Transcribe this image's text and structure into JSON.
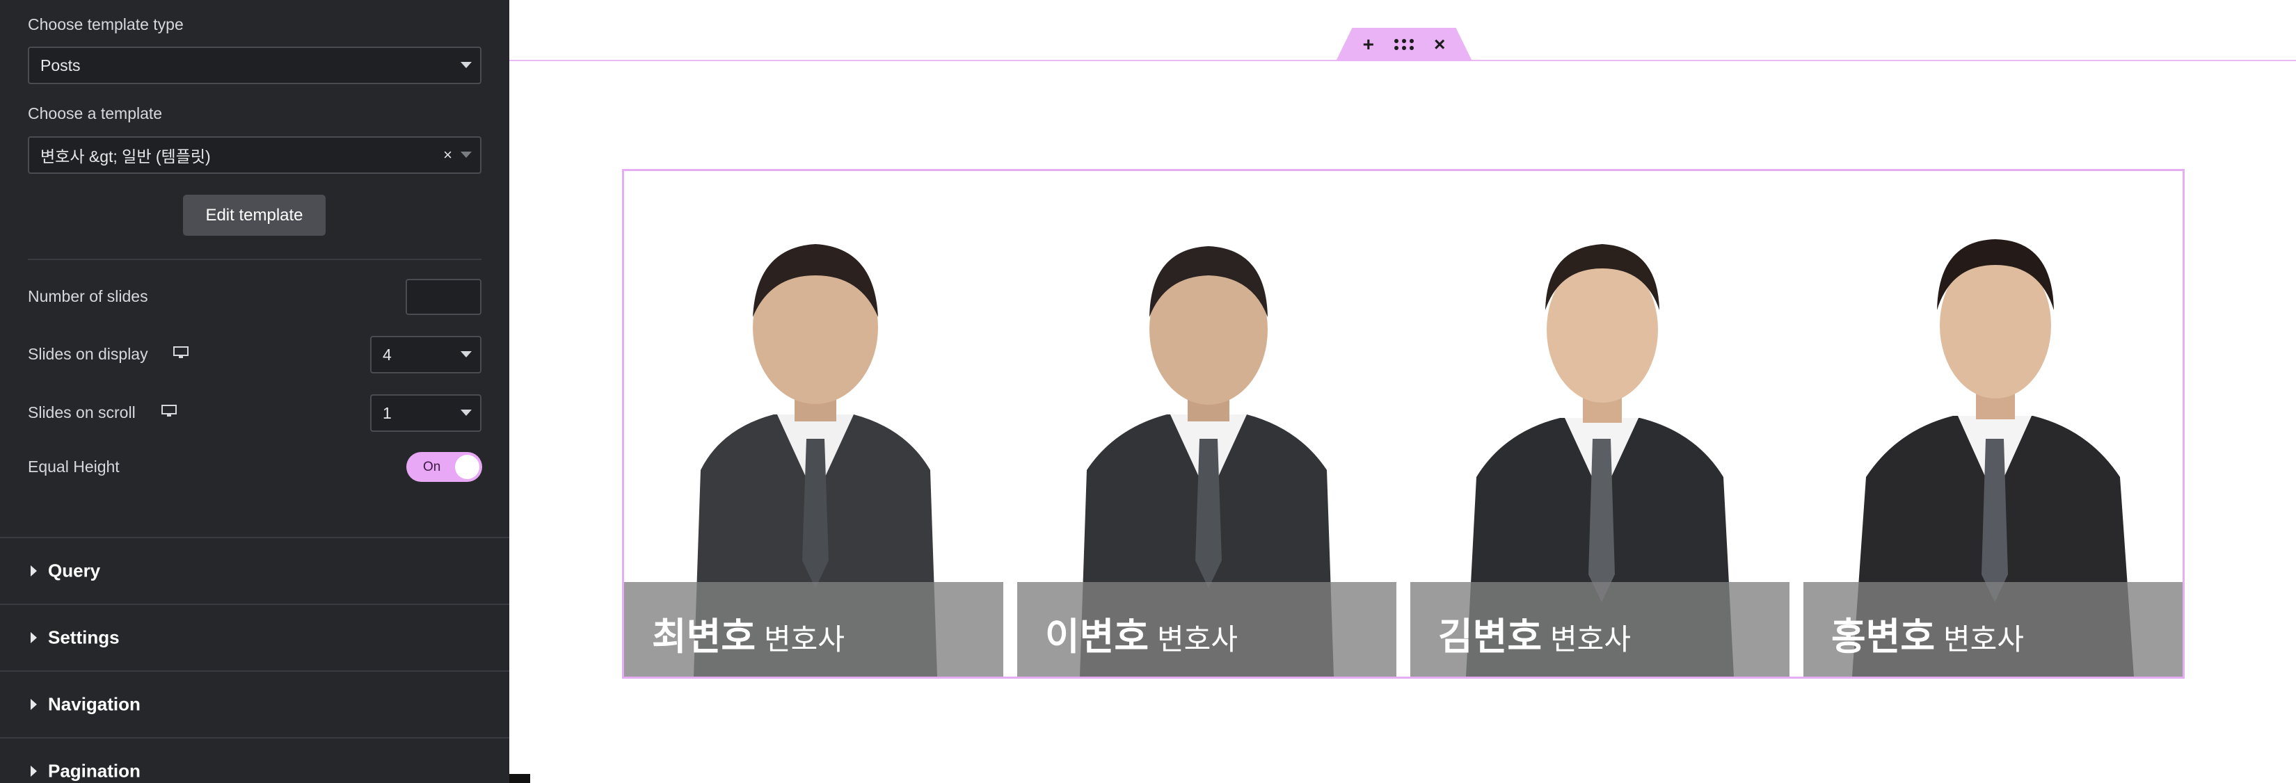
{
  "panel": {
    "template_type_label": "Choose template type",
    "template_type_value": "Posts",
    "template_label": "Choose a template",
    "template_value": "변호사 &gt; 일반 (템플릿)",
    "edit_template_label": "Edit template",
    "num_slides_label": "Number of slides",
    "num_slides_value": "",
    "slides_display_label": "Slides on display",
    "slides_display_value": "4",
    "slides_scroll_label": "Slides on scroll",
    "slides_scroll_value": "1",
    "equal_height_label": "Equal Height",
    "equal_height_value": "On",
    "sections": [
      {
        "label": "Query"
      },
      {
        "label": "Settings"
      },
      {
        "label": "Navigation"
      },
      {
        "label": "Pagination"
      }
    ]
  },
  "canvas": {
    "handle_icons": [
      "plus-icon",
      "drag-handle-icon",
      "close-icon"
    ],
    "handle_plus": "+",
    "handle_close": "×",
    "prev_arrow": "‹",
    "next_arrow": "›",
    "slides": [
      {
        "name": "최변호",
        "role": "변호사"
      },
      {
        "name": "이변호",
        "role": "변호사"
      },
      {
        "name": "김변호",
        "role": "변호사"
      },
      {
        "name": "홍변호",
        "role": "변호사"
      }
    ]
  },
  "colors": {
    "panel_bg": "#26272b",
    "accent": "#e9a8f5",
    "caption_bg": "#808080"
  }
}
